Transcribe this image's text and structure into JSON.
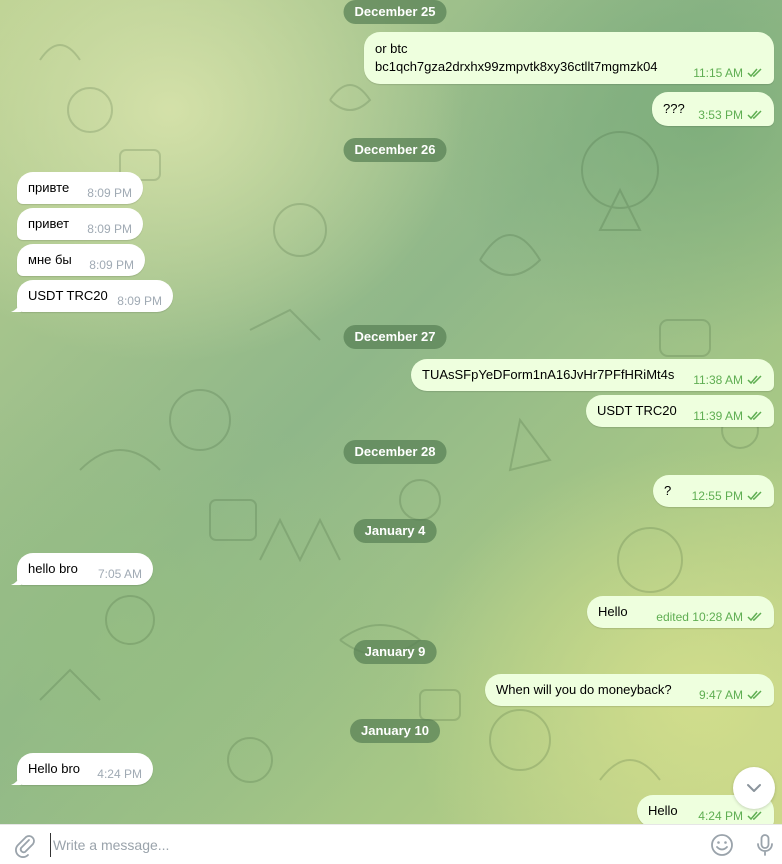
{
  "dates": {
    "d1": "December 25",
    "d2": "December 26",
    "d3": "December 27",
    "d4": "December 28",
    "d5": "January 4",
    "d6": "January 9",
    "d7": "January 10"
  },
  "messages": {
    "m1": {
      "line1": "or btc",
      "line2": "bc1qch7gza2drxhx99zmpvtk8xy36ctllt7mgmzk04",
      "time": "11:15 AM"
    },
    "m2": {
      "text": "???",
      "time": "3:53 PM"
    },
    "m3": {
      "text": "привте",
      "time": "8:09 PM"
    },
    "m4": {
      "text": "привет",
      "time": "8:09 PM"
    },
    "m5": {
      "text": "мне бы",
      "time": "8:09 PM"
    },
    "m6": {
      "text": "USDT TRC20",
      "time": "8:09 PM"
    },
    "m7": {
      "text": "TUAsSFpYeDForm1nA16JvHr7PFfHRiMt4s",
      "time": "11:38 AM"
    },
    "m8": {
      "text": "USDT TRC20",
      "time": "11:39 AM"
    },
    "m9": {
      "text": "?",
      "time": "12:55 PM"
    },
    "m10": {
      "text": "hello bro",
      "time": "7:05 AM"
    },
    "m11": {
      "text": "Hello",
      "time": "edited 10:28 AM"
    },
    "m12": {
      "text": "When will you do moneyback?",
      "time": "9:47 AM"
    },
    "m13": {
      "text": "Hello bro",
      "time": "4:24 PM"
    },
    "m14": {
      "text": "Hello",
      "time": "4:24 PM"
    }
  },
  "composer": {
    "placeholder": "Write a message..."
  },
  "icons": {
    "attach": "paperclip-icon",
    "emoji": "smile-icon",
    "voice": "microphone-icon",
    "scroll": "chevron-down-icon",
    "read": "double-check-icon"
  },
  "colors": {
    "incoming_bubble": "#ffffff",
    "outgoing_bubble": "#eeffde",
    "date_pill": "#578054",
    "read_check": "#5fae52"
  }
}
